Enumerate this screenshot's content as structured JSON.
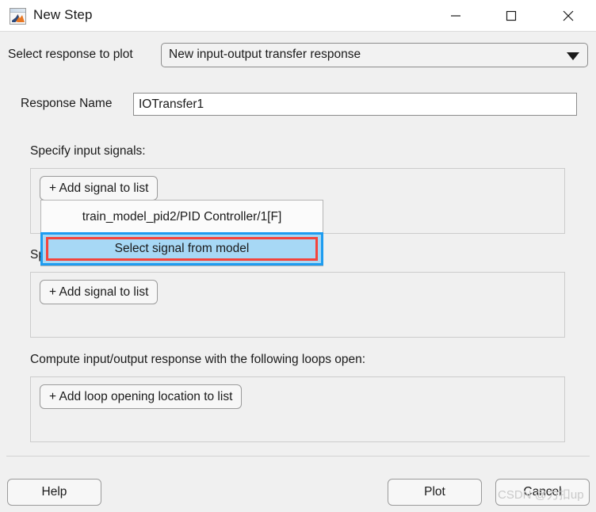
{
  "window": {
    "title": "New Step",
    "icon": "matlab-icon",
    "controls": {
      "minimize": "minimize-icon",
      "maximize": "maximize-icon",
      "close": "close-icon"
    }
  },
  "form": {
    "select_response_label": "Select response to plot",
    "response_type": {
      "value": "New input-output transfer response",
      "arrow_icon": "chevron-down-icon"
    },
    "response_name_label": "Response Name",
    "response_name_value": "IOTransfer1",
    "response_name_placeholder": ""
  },
  "sections": {
    "input_signals": {
      "label": "Specify input signals:",
      "add_button": "+ Add signal to list"
    },
    "output_signals": {
      "label": "Specify output signals:",
      "add_button": "+ Add signal to list"
    },
    "loops_open": {
      "label": "Compute input/output response with the following loops open:",
      "add_button": "+ Add loop opening location to list"
    }
  },
  "popup_menu": {
    "items": [
      {
        "label": "train_model_pid2/PID Controller/1[F]",
        "highlighted": false
      },
      {
        "label": "Select signal from model",
        "highlighted": true
      }
    ],
    "highlight_fill": "#a7d8f5",
    "highlight_border": "#1e9cf0",
    "annotation_border": "#f4443c"
  },
  "footer": {
    "help": "Help",
    "plot": "Plot",
    "cancel": "Cancel"
  },
  "watermark": "CSDN @力扣up"
}
